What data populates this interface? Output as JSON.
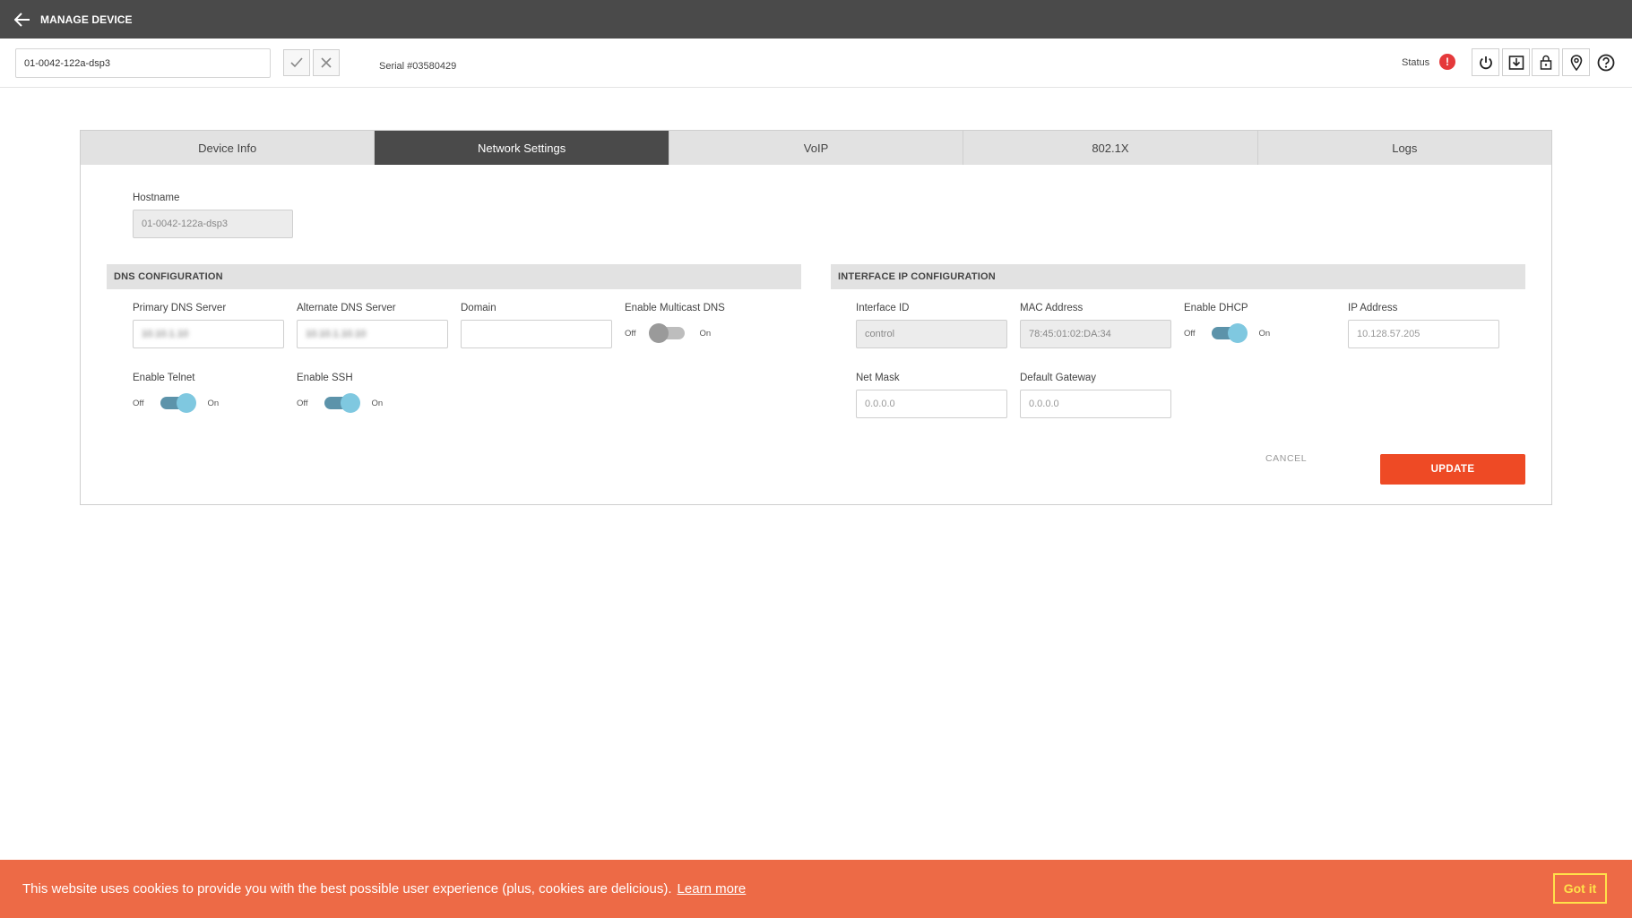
{
  "header": {
    "title": "MANAGE DEVICE"
  },
  "subheader": {
    "device_name": "01-0042-122a-dsp3",
    "serial": "Serial #03580429",
    "status_label": "Status",
    "status_icon": "!"
  },
  "tabs": [
    {
      "label": "Device Info",
      "active": false
    },
    {
      "label": "Network Settings",
      "active": true
    },
    {
      "label": "VoIP",
      "active": false
    },
    {
      "label": "802.1X",
      "active": false
    },
    {
      "label": "Logs",
      "active": false
    }
  ],
  "hostname": {
    "label": "Hostname",
    "value": "01-0042-122a-dsp3"
  },
  "dns": {
    "title": "DNS CONFIGURATION",
    "primary_label": "Primary DNS Server",
    "primary_value": "10.10.1.10",
    "alternate_label": "Alternate DNS Server",
    "alternate_value": "10.10.1.10.10",
    "domain_label": "Domain",
    "domain_value": "",
    "multicast_label": "Enable Multicast DNS",
    "telnet_label": "Enable Telnet",
    "ssh_label": "Enable SSH",
    "off": "Off",
    "on": "On"
  },
  "interface": {
    "title": "INTERFACE IP CONFIGURATION",
    "id_label": "Interface ID",
    "id_value": "control",
    "mac_label": "MAC Address",
    "mac_value": "78:45:01:02:DA:34",
    "dhcp_label": "Enable DHCP",
    "ip_label": "IP Address",
    "ip_value": "10.128.57.205",
    "netmask_label": "Net Mask",
    "netmask_value": "0.0.0.0",
    "gateway_label": "Default Gateway",
    "gateway_value": "0.0.0.0"
  },
  "actions": {
    "cancel": "CANCEL",
    "update": "UPDATE"
  },
  "cookie": {
    "message": "This website uses cookies to provide you with the best possible user experience (plus, cookies are delicious).",
    "learn_more": "Learn more",
    "got_it": "Got it"
  },
  "colors": {
    "accent": "#ee4a25",
    "header": "#4a4a4a",
    "toggle_on": "#7fc8e0",
    "cookie_bg": "#ed6a46"
  }
}
